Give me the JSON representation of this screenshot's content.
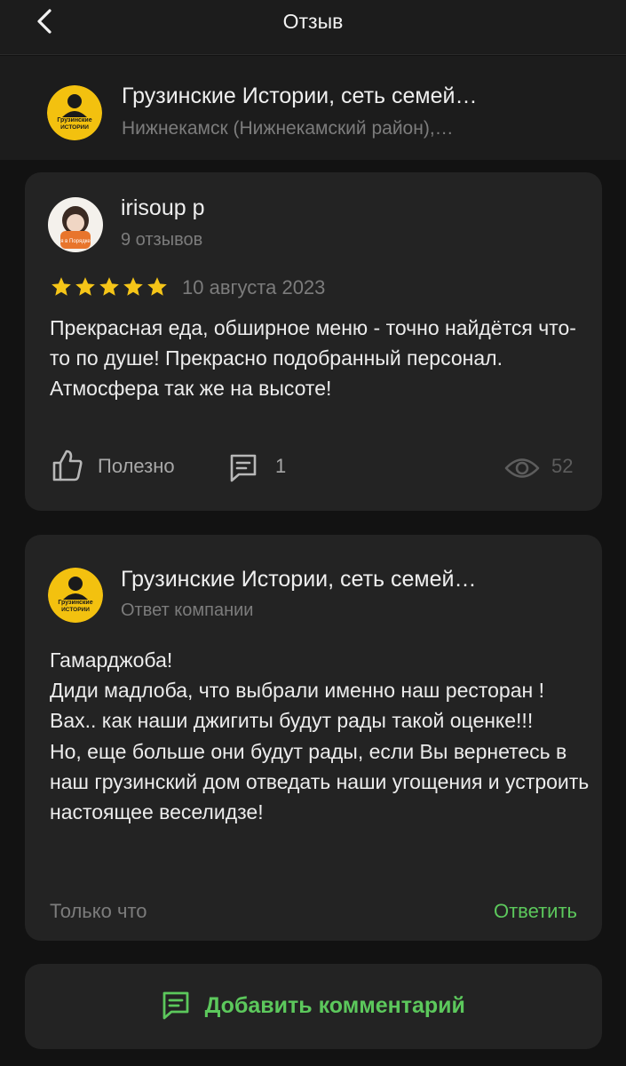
{
  "colors": {
    "background": "#121212",
    "card": "#232323",
    "accent": "#5cc85c",
    "star": "#f5c518",
    "muted": "#7c7c7c"
  },
  "topbar": {
    "title": "Отзыв",
    "back_icon": "chevron-left-icon"
  },
  "organization": {
    "name": "Грузинские Истории, сеть семей…",
    "location": "Нижнекамск (Нижнекамский район),…",
    "logo_text": [
      "Грузинские",
      "ИСТОРИИ"
    ]
  },
  "review": {
    "author": "irisoup p",
    "author_reviews": "9 отзывов",
    "rating": 5,
    "date": "10 августа 2023",
    "text": "Прекрасная еда, обширное меню - точно найдётся что-то по душе! Прекрасно подобранный персонал. Атмосфера так же на высоте!",
    "helpful_label": "Полезно",
    "comments_count": "1",
    "views_count": "52",
    "avatar_badge": "я в Порядке"
  },
  "reply": {
    "author": "Грузинские Истории, сеть семей…",
    "subtitle": "Ответ компании",
    "lines": [
      "Гамарджоба!",
      "Диди мадлоба, что выбрали именно наш ресторан ! Вах.. как наши джигиты будут рады такой оценке!!!",
      "Но, еще больше они будут рады, если Вы вернетесь в наш грузинский дом отведать наши угощения и устроить настоящее веселидзе!"
    ],
    "time": "Только что",
    "reply_button": "Ответить"
  },
  "add_comment": {
    "label": "Добавить комментарий",
    "icon": "comment-icon"
  }
}
